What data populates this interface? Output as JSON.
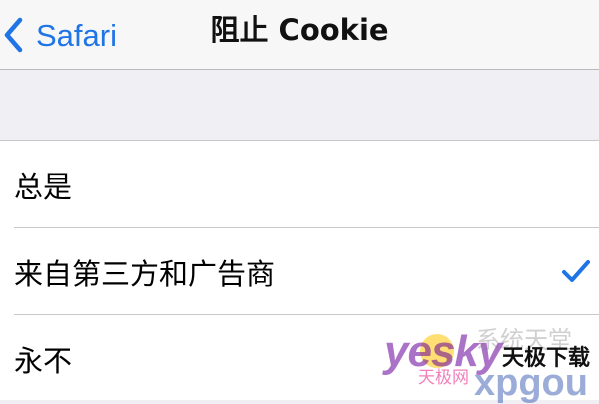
{
  "nav": {
    "back_label": "Safari",
    "title": "阻止 Cookie"
  },
  "options": [
    {
      "label": "总是",
      "selected": false
    },
    {
      "label": "来自第三方和广告商",
      "selected": true
    },
    {
      "label": "永不",
      "selected": false
    }
  ],
  "watermark": {
    "logo": "yesky",
    "sub": "天极网",
    "grey_text": "系统天堂",
    "right_text": "天极下载",
    "bottom_text": "xpgou"
  },
  "icons": {
    "back": "chevron-left-icon",
    "selected": "checkmark-icon"
  },
  "colors": {
    "accent": "#1f74e6",
    "nav_background": "#f7f7f8",
    "group_background": "#efeff4",
    "row_background": "#ffffff",
    "separator": "#c8c7cc"
  }
}
